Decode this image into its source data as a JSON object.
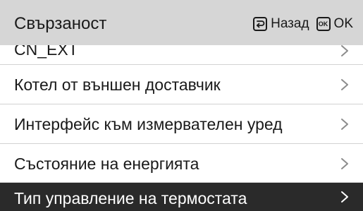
{
  "header": {
    "title": "Свързаност",
    "back_label": "Назад",
    "back_icon": "back-return-icon",
    "ok_key_text": "OK",
    "ok_label": "OK",
    "ok_icon": "ok-key-icon"
  },
  "menu": {
    "items": [
      {
        "label": "CN_EXT",
        "icon": "chevron-right-icon"
      },
      {
        "label": "Котел от външен доставчик",
        "icon": "chevron-right-icon"
      },
      {
        "label": "Интерфейс към измервателен уред",
        "icon": "chevron-right-icon"
      },
      {
        "label": "Състояние на енергията",
        "icon": "chevron-right-icon"
      },
      {
        "label": "Тип управление на термостата",
        "icon": "chevron-right-icon",
        "selected": true
      }
    ]
  },
  "colors": {
    "header_bg": "#d6d6d6",
    "selected_bg": "#2a2a2a",
    "text": "#1a1a1a",
    "divider": "#d2d2d2",
    "chevron": "#8c8c8c"
  }
}
